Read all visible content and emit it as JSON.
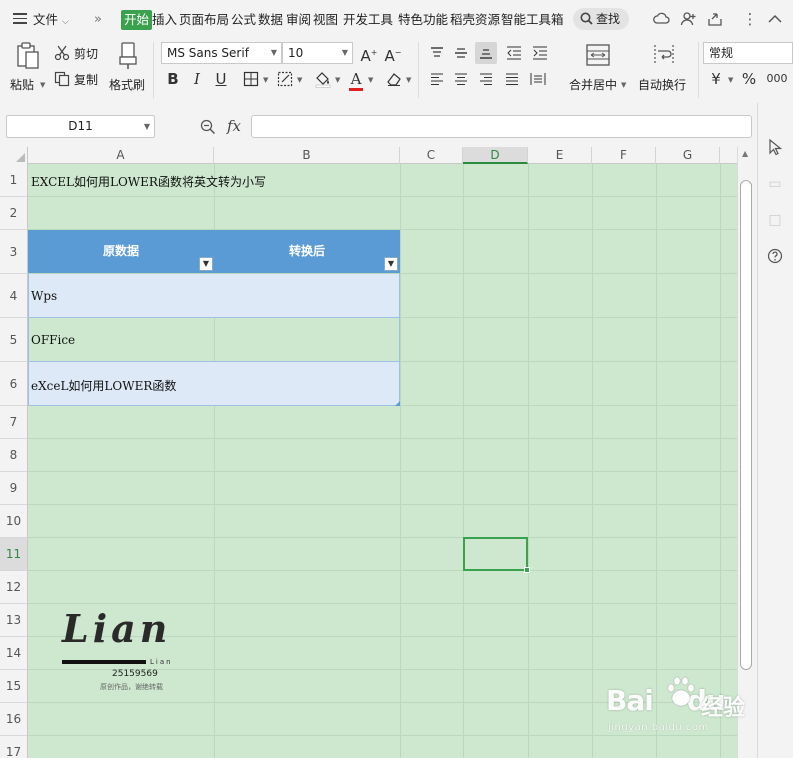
{
  "menu": {
    "file_label": "文件",
    "tabs": [
      "开始",
      "插入",
      "页面布局",
      "公式",
      "数据",
      "审阅",
      "视图",
      "开发工具",
      "特色功能",
      "稻壳资源",
      "智能工具箱"
    ],
    "search_label": "查找"
  },
  "ribbon": {
    "paste_label": "粘贴",
    "cut_label": "剪切",
    "copy_label": "复制",
    "format_painter_label": "格式刷",
    "font_name": "MS Sans Serif",
    "font_size": "10",
    "merge_label": "合并居中",
    "wrap_label": "自动换行",
    "number_format": "常规",
    "currency_symbol": "¥",
    "percent_symbol": "%",
    "thousands_symbol": "000"
  },
  "formula_bar": {
    "name_box": "D11",
    "fx_label": "fx",
    "formula": ""
  },
  "sheet": {
    "columns": [
      "A",
      "B",
      "C",
      "D",
      "E",
      "F",
      "G"
    ],
    "rows": [
      "1",
      "2",
      "3",
      "4",
      "5",
      "6",
      "7",
      "8",
      "9",
      "10",
      "11",
      "12",
      "13",
      "14",
      "15",
      "16",
      "17"
    ],
    "selected_column": "D",
    "selected_row": "11",
    "title_cell": "EXCEL如何用LOWER函数将英文转为小写",
    "table_headers": [
      "原数据",
      "转换后"
    ],
    "table_rows": [
      "Wps",
      "OFFice",
      "eXceL如何用LOWER函数"
    ]
  },
  "logo": {
    "word": "Lian",
    "small": "Lian",
    "number": "25159569",
    "note": "原创作品，谢绝转载"
  },
  "watermark": {
    "brand": "Bai",
    "brand_suffix": "du",
    "cn": "经验",
    "url": "jingyan.baidu.com"
  },
  "colors": {
    "accent": "#3aa14f",
    "sheet_bg": "#cde8cf",
    "table_header": "#5b9bd5",
    "table_band": "#dde9f6"
  }
}
